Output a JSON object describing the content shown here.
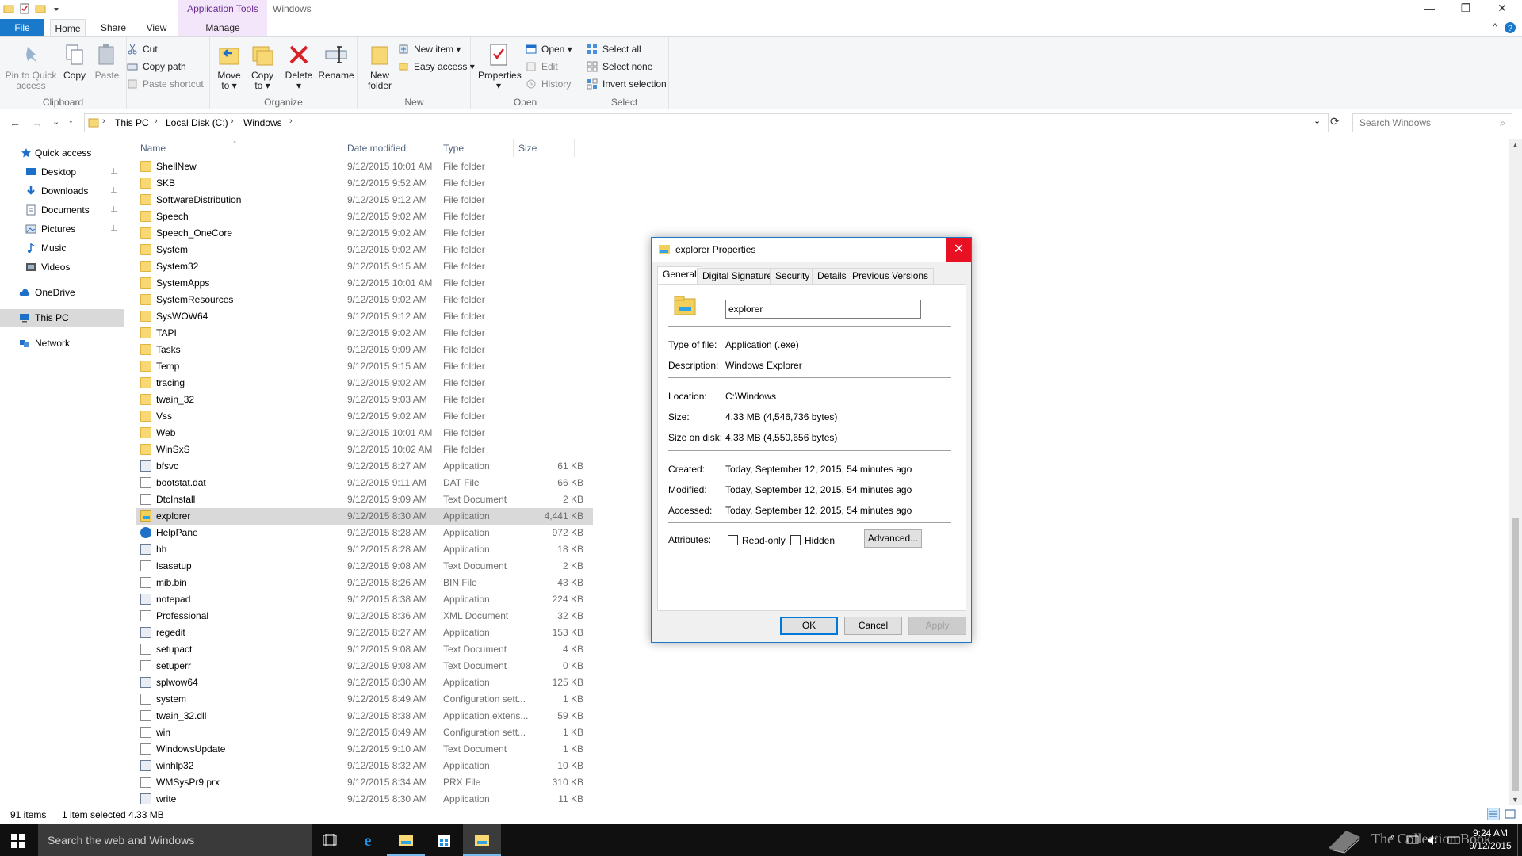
{
  "titlebar": {
    "context_tab_title": "Application Tools",
    "window_title": "Windows",
    "minimize": "—",
    "restore": "❐",
    "close": "✕"
  },
  "ribbon_tabs": {
    "file": "File",
    "home": "Home",
    "share": "Share",
    "view": "View",
    "manage": "Manage"
  },
  "ribbon": {
    "clipboard": {
      "label": "Clipboard",
      "pin_line1": "Pin to Quick",
      "pin_line2": "access",
      "copy": "Copy",
      "paste": "Paste",
      "cut": "Cut",
      "copy_path": "Copy path",
      "paste_shortcut": "Paste shortcut"
    },
    "organize": {
      "label": "Organize",
      "move_line1": "Move",
      "move_line2": "to ▾",
      "copyto_line1": "Copy",
      "copyto_line2": "to ▾",
      "delete": "Delete",
      "delete_caret": "▾",
      "rename": "Rename"
    },
    "new": {
      "label": "New",
      "new_folder_line1": "New",
      "new_folder_line2": "folder",
      "new_item": "New item ▾",
      "easy_access": "Easy access ▾"
    },
    "open": {
      "label": "Open",
      "properties": "Properties",
      "properties_caret": "▾",
      "open": "Open ▾",
      "edit": "Edit",
      "history": "History"
    },
    "select": {
      "label": "Select",
      "select_all": "Select all",
      "select_none": "Select none",
      "invert": "Invert selection"
    }
  },
  "addressbar": {
    "back": "←",
    "forward": "→",
    "recent": "⌄",
    "up": "↑",
    "crumbs": [
      "This PC",
      "Local Disk (C:)",
      "Windows"
    ],
    "separator": "›",
    "dropdown": "⌄",
    "refresh": "⟳",
    "search_placeholder": "Search Windows",
    "search_icon": "⌕"
  },
  "nav": {
    "quick_access": "Quick access",
    "desktop": "Desktop",
    "downloads": "Downloads",
    "documents": "Documents",
    "pictures": "Pictures",
    "music": "Music",
    "videos": "Videos",
    "onedrive": "OneDrive",
    "this_pc": "This PC",
    "network": "Network",
    "pin_glyph": "📌"
  },
  "columns": {
    "name": "Name",
    "date": "Date modified",
    "type": "Type",
    "size": "Size",
    "sort_glyph": "^"
  },
  "files": [
    {
      "name": "ShellNew",
      "date": "9/12/2015 10:01 AM",
      "type": "File folder",
      "size": "",
      "icon": "folder"
    },
    {
      "name": "SKB",
      "date": "9/12/2015 9:52 AM",
      "type": "File folder",
      "size": "",
      "icon": "folder"
    },
    {
      "name": "SoftwareDistribution",
      "date": "9/12/2015 9:12 AM",
      "type": "File folder",
      "size": "",
      "icon": "folder"
    },
    {
      "name": "Speech",
      "date": "9/12/2015 9:02 AM",
      "type": "File folder",
      "size": "",
      "icon": "folder"
    },
    {
      "name": "Speech_OneCore",
      "date": "9/12/2015 9:02 AM",
      "type": "File folder",
      "size": "",
      "icon": "folder"
    },
    {
      "name": "System",
      "date": "9/12/2015 9:02 AM",
      "type": "File folder",
      "size": "",
      "icon": "folder"
    },
    {
      "name": "System32",
      "date": "9/12/2015 9:15 AM",
      "type": "File folder",
      "size": "",
      "icon": "folder"
    },
    {
      "name": "SystemApps",
      "date": "9/12/2015 10:01 AM",
      "type": "File folder",
      "size": "",
      "icon": "folder"
    },
    {
      "name": "SystemResources",
      "date": "9/12/2015 9:02 AM",
      "type": "File folder",
      "size": "",
      "icon": "folder"
    },
    {
      "name": "SysWOW64",
      "date": "9/12/2015 9:12 AM",
      "type": "File folder",
      "size": "",
      "icon": "folder"
    },
    {
      "name": "TAPI",
      "date": "9/12/2015 9:02 AM",
      "type": "File folder",
      "size": "",
      "icon": "folder"
    },
    {
      "name": "Tasks",
      "date": "9/12/2015 9:09 AM",
      "type": "File folder",
      "size": "",
      "icon": "folder"
    },
    {
      "name": "Temp",
      "date": "9/12/2015 9:15 AM",
      "type": "File folder",
      "size": "",
      "icon": "folder"
    },
    {
      "name": "tracing",
      "date": "9/12/2015 9:02 AM",
      "type": "File folder",
      "size": "",
      "icon": "folder"
    },
    {
      "name": "twain_32",
      "date": "9/12/2015 9:03 AM",
      "type": "File folder",
      "size": "",
      "icon": "folder"
    },
    {
      "name": "Vss",
      "date": "9/12/2015 9:02 AM",
      "type": "File folder",
      "size": "",
      "icon": "folder"
    },
    {
      "name": "Web",
      "date": "9/12/2015 10:01 AM",
      "type": "File folder",
      "size": "",
      "icon": "folder"
    },
    {
      "name": "WinSxS",
      "date": "9/12/2015 10:02 AM",
      "type": "File folder",
      "size": "",
      "icon": "folder"
    },
    {
      "name": "bfsvc",
      "date": "9/12/2015 8:27 AM",
      "type": "Application",
      "size": "61 KB",
      "icon": "app"
    },
    {
      "name": "bootstat.dat",
      "date": "9/12/2015 9:11 AM",
      "type": "DAT File",
      "size": "66 KB",
      "icon": "file"
    },
    {
      "name": "DtcInstall",
      "date": "9/12/2015 9:09 AM",
      "type": "Text Document",
      "size": "2 KB",
      "icon": "file"
    },
    {
      "name": "explorer",
      "date": "9/12/2015 8:30 AM",
      "type": "Application",
      "size": "4,441 KB",
      "icon": "explorer",
      "selected": true
    },
    {
      "name": "HelpPane",
      "date": "9/12/2015 8:28 AM",
      "type": "Application",
      "size": "972 KB",
      "icon": "help"
    },
    {
      "name": "hh",
      "date": "9/12/2015 8:28 AM",
      "type": "Application",
      "size": "18 KB",
      "icon": "app"
    },
    {
      "name": "lsasetup",
      "date": "9/12/2015 9:08 AM",
      "type": "Text Document",
      "size": "2 KB",
      "icon": "file"
    },
    {
      "name": "mib.bin",
      "date": "9/12/2015 8:26 AM",
      "type": "BIN File",
      "size": "43 KB",
      "icon": "file"
    },
    {
      "name": "notepad",
      "date": "9/12/2015 8:38 AM",
      "type": "Application",
      "size": "224 KB",
      "icon": "app"
    },
    {
      "name": "Professional",
      "date": "9/12/2015 8:36 AM",
      "type": "XML Document",
      "size": "32 KB",
      "icon": "file"
    },
    {
      "name": "regedit",
      "date": "9/12/2015 8:27 AM",
      "type": "Application",
      "size": "153 KB",
      "icon": "app"
    },
    {
      "name": "setupact",
      "date": "9/12/2015 9:08 AM",
      "type": "Text Document",
      "size": "4 KB",
      "icon": "file"
    },
    {
      "name": "setuperr",
      "date": "9/12/2015 9:08 AM",
      "type": "Text Document",
      "size": "0 KB",
      "icon": "file"
    },
    {
      "name": "splwow64",
      "date": "9/12/2015 8:30 AM",
      "type": "Application",
      "size": "125 KB",
      "icon": "app"
    },
    {
      "name": "system",
      "date": "9/12/2015 8:49 AM",
      "type": "Configuration sett...",
      "size": "1 KB",
      "icon": "file"
    },
    {
      "name": "twain_32.dll",
      "date": "9/12/2015 8:38 AM",
      "type": "Application extens...",
      "size": "59 KB",
      "icon": "file"
    },
    {
      "name": "win",
      "date": "9/12/2015 8:49 AM",
      "type": "Configuration sett...",
      "size": "1 KB",
      "icon": "file"
    },
    {
      "name": "WindowsUpdate",
      "date": "9/12/2015 9:10 AM",
      "type": "Text Document",
      "size": "1 KB",
      "icon": "file"
    },
    {
      "name": "winhlp32",
      "date": "9/12/2015 8:32 AM",
      "type": "Application",
      "size": "10 KB",
      "icon": "app"
    },
    {
      "name": "WMSysPr9.prx",
      "date": "9/12/2015 8:34 AM",
      "type": "PRX File",
      "size": "310 KB",
      "icon": "file"
    },
    {
      "name": "write",
      "date": "9/12/2015 8:30 AM",
      "type": "Application",
      "size": "11 KB",
      "icon": "app"
    }
  ],
  "status": {
    "items": "91 items",
    "selected": "1 item selected  4.33 MB"
  },
  "taskbar": {
    "search_placeholder": "Search the web and Windows",
    "watermark": "The Collection Book",
    "time": "9:24 AM",
    "date": "9/12/2015"
  },
  "dialog": {
    "title": "explorer Properties",
    "close": "✕",
    "tabs": [
      "General",
      "Digital Signatures",
      "Security",
      "Details",
      "Previous Versions"
    ],
    "name_value": "explorer",
    "type_label": "Type of file:",
    "type_value": "Application (.exe)",
    "desc_label": "Description:",
    "desc_value": "Windows Explorer",
    "location_label": "Location:",
    "location_value": "C:\\Windows",
    "size_label": "Size:",
    "size_value": "4.33 MB (4,546,736 bytes)",
    "sizedisk_label": "Size on disk:",
    "sizedisk_value": "4.33 MB (4,550,656 bytes)",
    "created_label": "Created:",
    "created_value": "Today, September 12, 2015, 54 minutes ago",
    "modified_label": "Modified:",
    "modified_value": "Today, September 12, 2015, 54 minutes ago",
    "accessed_label": "Accessed:",
    "accessed_value": "Today, September 12, 2015, 54 minutes ago",
    "attributes_label": "Attributes:",
    "readonly_label": "Read-only",
    "hidden_label": "Hidden",
    "advanced_button": "Advanced...",
    "ok_button": "OK",
    "cancel_button": "Cancel",
    "apply_button": "Apply"
  }
}
